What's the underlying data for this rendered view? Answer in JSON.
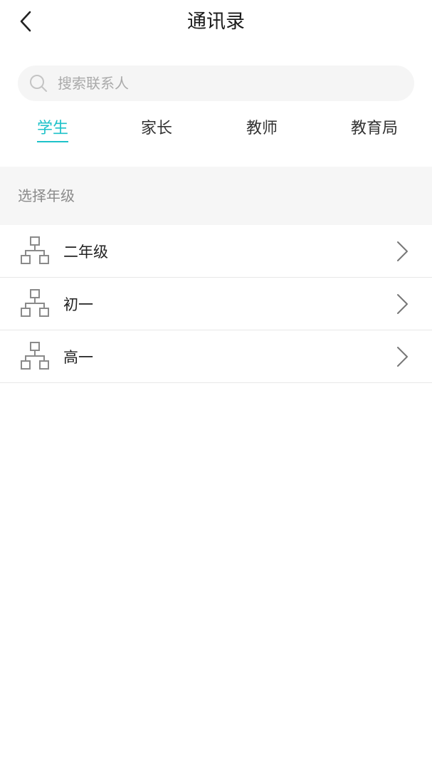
{
  "header": {
    "title": "通讯录"
  },
  "search": {
    "placeholder": "搜索联系人",
    "value": ""
  },
  "tabs": [
    {
      "label": "学生",
      "active": true
    },
    {
      "label": "家长",
      "active": false
    },
    {
      "label": "教师",
      "active": false
    },
    {
      "label": "教育局",
      "active": false
    }
  ],
  "section": {
    "title": "选择年级"
  },
  "grades": [
    {
      "label": "二年级"
    },
    {
      "label": "初一"
    },
    {
      "label": "高一"
    }
  ],
  "colors": {
    "accent": "#1ec2c9",
    "section_bg": "#f6f6f6",
    "divider": "#e7e7e7"
  },
  "icons": {
    "back": "chevron-left-icon",
    "search": "search-icon",
    "grade": "org-chart-icon",
    "row_arrow": "chevron-right-icon"
  }
}
